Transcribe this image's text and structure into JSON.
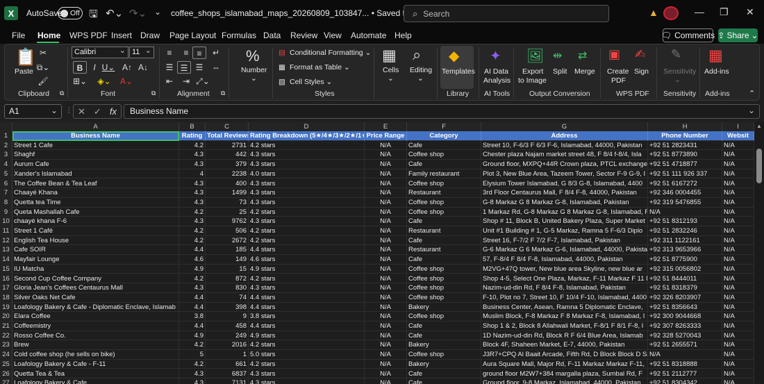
{
  "titlebar": {
    "app_logo": "X",
    "autosave_label": "AutoSave",
    "autosave_state": "Off",
    "filename": "coffee_shops_islamabad_maps_20260809_103847...",
    "saved_status": "• Saved to this PC ⌄",
    "search_placeholder": "Search"
  },
  "menu": {
    "items": [
      "File",
      "Home",
      "WPS PDF",
      "Insert",
      "Draw",
      "Page Layout",
      "Formulas",
      "Data",
      "Review",
      "View",
      "Automate",
      "Help"
    ],
    "active": "Home",
    "comments_label": "Comments",
    "share_label": "Share"
  },
  "ribbon": {
    "clipboard": {
      "paste": "Paste",
      "group": "Clipboard"
    },
    "font": {
      "name": "Calibri",
      "size": "11",
      "group": "Font"
    },
    "alignment": {
      "group": "Alignment"
    },
    "number": {
      "label": "Number"
    },
    "styles": {
      "conditional": "Conditional Formatting ⌄",
      "format_table": "Format as Table ⌄",
      "cell_styles": "Cell Styles ⌄",
      "group": "Styles"
    },
    "cells": {
      "label": "Cells"
    },
    "editing": {
      "label": "Editing"
    },
    "library": {
      "templates": "Templates",
      "group": "Library"
    },
    "ai": {
      "label1": "AI Data",
      "label2": "Analysis",
      "group": "AI Tools"
    },
    "conversion": {
      "export1": "Export",
      "export2": "to Image",
      "split": "Split",
      "merge": "Merge",
      "group": "Output Conversion"
    },
    "wps": {
      "create1": "Create",
      "create2": "PDF",
      "sign": "Sign",
      "group": "WPS PDF"
    },
    "sensitivity": {
      "label": "Sensitivity",
      "group": "Sensitivity"
    },
    "addins": {
      "label": "Add-ins",
      "group": "Add-ins"
    }
  },
  "formula_bar": {
    "name_box": "A1",
    "fx": "fx",
    "content": "Business Name"
  },
  "sheet": {
    "columns": [
      "A",
      "B",
      "C",
      "D",
      "E",
      "F",
      "G",
      "H",
      "I"
    ],
    "headers": [
      "Business Name",
      "Rating",
      "Total Reviews",
      "Rating Breakdown (5★/4★/3★/2★/1★)",
      "Price Range",
      "Category",
      "Address",
      "Phone Number",
      "Websit"
    ],
    "rows": [
      [
        "Street 1 Cafe",
        "4.2",
        "2731",
        "4.2 stars",
        "N/A",
        "Cafe",
        "Street 10, F-6/3 F 6/3 F-6, Islamabad, 44000, Pakistan",
        "+92 51 2823431",
        "N/A"
      ],
      [
        "Shaghf",
        "4.3",
        "442",
        "4.3 stars",
        "N/A",
        "Coffee shop",
        "Chester plaza Najam market street 48, F 8/4 f-8/4, Isla",
        "+92 51 8773890",
        "N/A"
      ],
      [
        "Aurum Cafe",
        "4.3",
        "379",
        "4.3 stars",
        "N/A",
        "Cafe",
        "Ground floor, MXPQ+44R Crown plaza, PTCL exchange, S",
        "+92 51 4718877",
        "N/A"
      ],
      [
        "Xander's Islamabad",
        "4",
        "2238",
        "4.0 stars",
        "N/A",
        "Family restaurant",
        "Plot 3, New Blue Area, Tazeem Tower, Sector F-9 G-9, I",
        "+92 51 111 926 337",
        "N/A"
      ],
      [
        "The Coffee Bean & Tea Leaf",
        "4.3",
        "400",
        "4.3 stars",
        "N/A",
        "Coffee shop",
        "Elysium Tower Islamabad, G 8/3 G-8, Islamabad, 4400",
        "+92 51 6167272",
        "N/A"
      ],
      [
        "Chaayé Khana",
        "4.3",
        "1499",
        "4.3 stars",
        "N/A",
        "Restaurant",
        "3rd Floor Centaurus Mall, F 8/4 F-8, 44000, Pakistan",
        "+92 346 0004455",
        "N/A"
      ],
      [
        "Quetta tea Time",
        "4.3",
        "73",
        "4.3 stars",
        "N/A",
        "Coffee shop",
        "G-8 Markaz G 8 Markaz G-8, Islamabad, Pakistan",
        "+92 319 5476855",
        "N/A"
      ],
      [
        "Queta Mashallah Cafe",
        "4.2",
        "25",
        "4.2 stars",
        "N/A",
        "Coffee shop",
        "1 Markaz Rd, G-8 Markaz G 8 Markaz G-8, Islamabad, F",
        "N/A",
        "N/A"
      ],
      [
        "chaayé khana F-6",
        "4.3",
        "9762",
        "4.3 stars",
        "N/A",
        "Cafe",
        "Shop # 11, Block B, United Bakery Plaza, Super Market",
        "+92 51 8312193",
        "N/A"
      ],
      [
        "Street 1 Café",
        "4.2",
        "506",
        "4.2 stars",
        "N/A",
        "Restaurant",
        "Unit #1 Building # 1, G-5 Markaz, Ramna 5 F-6/3 Diplo",
        "+92 51 2832246",
        "N/A"
      ],
      [
        "English Tea House",
        "4.2",
        "2672",
        "4.2 stars",
        "N/A",
        "Cafe",
        "Street 16, F-7/2 F 7/2 F-7, Islamabad, Pakistan",
        "+92 311 1122161",
        "N/A"
      ],
      [
        "Cafe SOIR",
        "4.4",
        "185",
        "4.4 stars",
        "N/A",
        "Restaurant",
        "G-6 Markaz G 6 Markaz G-6, Islamabad, 44000, Pakista",
        "+92 313 9653966",
        "N/A"
      ],
      [
        "Mayfair Lounge",
        "4.6",
        "149",
        "4.6 stars",
        "N/A",
        "Cafe",
        "57, F-8/4 F 8/4 F-8, Islamabad, 44000, Pakistan",
        "+92 51 8775900",
        "N/A"
      ],
      [
        "IU Matcha",
        "4.9",
        "15",
        "4.9 stars",
        "N/A",
        "Coffee shop",
        "M2VG+47Q tower, New blue area Skyline, new blue ar",
        "+92 315 0056802",
        "N/A"
      ],
      [
        "Second Cup Coffee Company",
        "4.2",
        "872",
        "4.2 stars",
        "N/A",
        "Coffee shop",
        "Shop 4-5, Select One Plaza, Markaz, F-11 Markaz F 11 M",
        "+92 51 8444011",
        "N/A"
      ],
      [
        "Gloria Jean's Coffees Centaurus Mall",
        "4.3",
        "830",
        "4.3 stars",
        "N/A",
        "Coffee shop",
        "Nazim-ud-din Rd, F 8/4 F-8, Islamabad, Pakistan",
        "+92 51 8318379",
        "N/A"
      ],
      [
        "Silver Oaks Net Cafe",
        "4.4",
        "74",
        "4.4 stars",
        "N/A",
        "Coffee shop",
        "F-10, Plot no 7, Street 10, F 10/4 F-10, Islamabad, 4400",
        "+92 326 8203907",
        "N/A"
      ],
      [
        "Loafology Bakery & Cafe - Diplomatic Enclave, Islamab",
        "4.4",
        "398",
        "4.4 stars",
        "N/A",
        "Bakery",
        "Business Center, Asean, Ramna 5 Diplomatic Enclave,",
        "+92 51 8356643",
        "N/A"
      ],
      [
        "Elara Coffee",
        "3.8",
        "9",
        "3.8 stars",
        "N/A",
        "Coffee shop",
        "Muslim Block, F-8 Markaz F 8 Markaz F-8, Islamabad, I",
        "+92 300 9044668",
        "N/A"
      ],
      [
        "Coffeemistry",
        "4.4",
        "458",
        "4.4 stars",
        "N/A",
        "Cafe",
        "Shop 1 & 2, Block 8 Allahwali Market, F-8/1 F 8/1 F-8, I",
        "+92 307 8263333",
        "N/A"
      ],
      [
        "Rosso Coffee Co.",
        "4.9",
        "249",
        "4.9 stars",
        "N/A",
        "Cafe",
        "1D Nazim-ud-din Rd, Block R F 6/4 Blue Area, Islamab",
        "+92 328 5270043",
        "N/A"
      ],
      [
        "Brew",
        "4.2",
        "2016",
        "4.2 stars",
        "N/A",
        "Bakery",
        "Block 4F, Shaheen Market, E-7, 44000, Pakistan",
        "+92 51 2655571",
        "N/A"
      ],
      [
        "Cold coffee shop (he sells on bike)",
        "5",
        "1",
        "5.0 stars",
        "N/A",
        "Coffee shop",
        "J3R7+CPQ Al Baait Arcade, Fifth Rd, D Block Block D Sat",
        "N/A",
        "N/A"
      ],
      [
        "Loafology Bakery & Cafe - F-11",
        "4.2",
        "661",
        "4.2 stars",
        "N/A",
        "Bakery",
        "Aura Square Mall, Major Rd, F-11 Markaz Markaz F-11,",
        "+92 51 8318888",
        "N/A"
      ],
      [
        "Quetta Tea & Tea",
        "4.3",
        "6837",
        "4.3 stars",
        "N/A",
        "Cafe",
        "ground floor M2W7+384 margalla plaza, Sumbal Rd, F",
        "+92 51 2112777",
        "N/A"
      ],
      [
        "Loafology Bakery & Cafe",
        "4.3",
        "7131",
        "4.3 stars",
        "N/A",
        "Cafe",
        "Ground floor, 9-8 Markaz, Islamabad, 44000, Pakistan",
        "+92 51 8304342",
        "N/A"
      ]
    ]
  }
}
